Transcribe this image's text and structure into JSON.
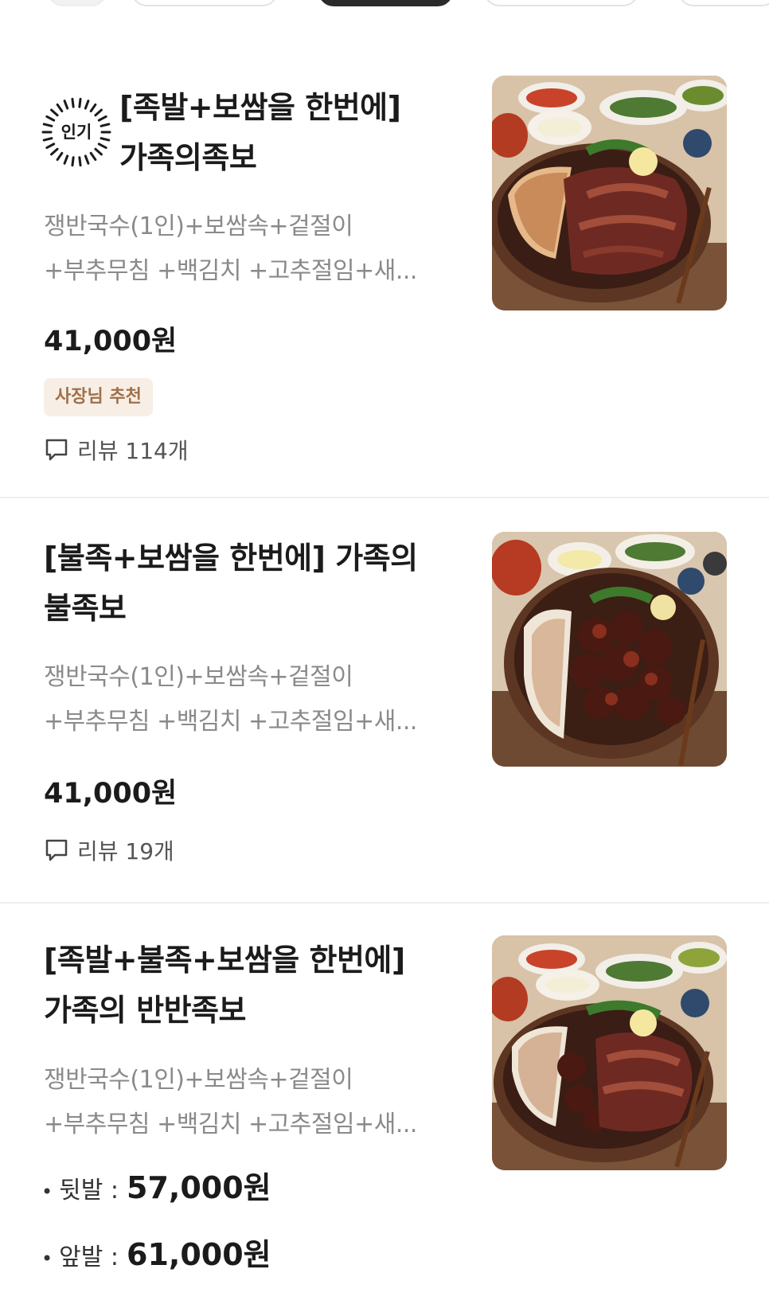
{
  "items": [
    {
      "badge": "인기",
      "title_lines": [
        "[족발+보쌈을 한번에]",
        "가족의족보"
      ],
      "desc_lines": [
        "쟁반국수(1인)+보쌈속+겉절이",
        "+부추무침 +백김치 +고추절임+새..."
      ],
      "price": "41,000원",
      "tag": "사장님 추천",
      "review": "리뷰 114개"
    },
    {
      "title_lines": [
        "[불족+보쌈을 한번에] 가족의",
        "불족보"
      ],
      "desc_lines": [
        "쟁반국수(1인)+보쌈속+겉절이",
        "+부추무침 +백김치 +고추절임+새..."
      ],
      "price": "41,000원",
      "review": "리뷰 19개"
    },
    {
      "title_lines": [
        "[족발+불족+보쌈을 한번에]",
        "가족의 반반족보"
      ],
      "desc_lines": [
        "쟁반국수(1인)+보쌈속+겉절이",
        "+부추무침 +백김치 +고추절임+새..."
      ],
      "options": [
        {
          "label": "뒷발 :",
          "price": "57,000원"
        },
        {
          "label": "앞발 :",
          "price": "61,000원"
        }
      ]
    }
  ],
  "colors": {
    "tag_bg": "#f7efe6",
    "tag_text": "#a0704a",
    "desc": "#8a8a8a",
    "divider": "#efefef"
  },
  "icons": {
    "review": "speech-bubble-icon",
    "popular": "sunburst-badge-icon"
  }
}
